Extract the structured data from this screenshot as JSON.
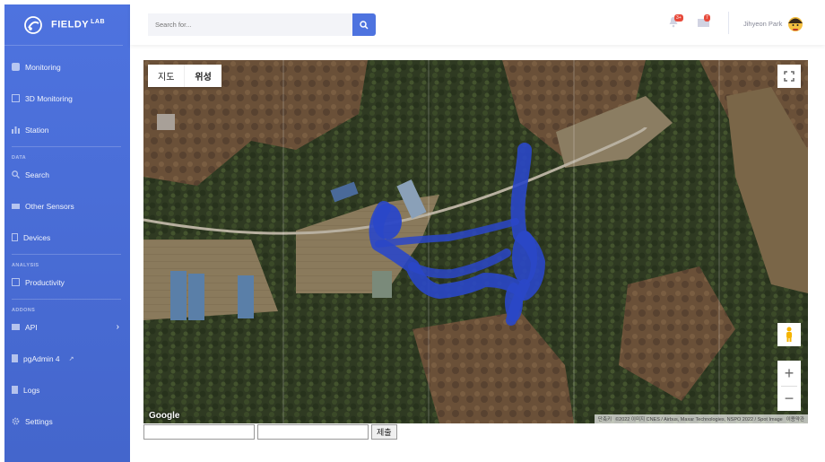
{
  "brand": {
    "name": "FIELDY",
    "sup": "LAB"
  },
  "sidebar": {
    "items": [
      {
        "label": "Monitoring",
        "icon": "map-icon"
      },
      {
        "label": "3D Monitoring",
        "icon": "cube-icon"
      },
      {
        "label": "Station",
        "icon": "bar-chart-icon"
      }
    ],
    "section_data": "DATA",
    "data_items": [
      {
        "label": "Search",
        "icon": "search-icon"
      },
      {
        "label": "Other Sensors",
        "icon": "sensor-icon"
      },
      {
        "label": "Devices",
        "icon": "device-icon"
      }
    ],
    "section_analysis": "ANALYSIS",
    "analysis_items": [
      {
        "label": "Productivity",
        "icon": "table-icon"
      }
    ],
    "section_addons": "ADDONS",
    "addon_items": [
      {
        "label": "API",
        "icon": "folder-icon"
      },
      {
        "label": "pgAdmin 4",
        "icon": "file-icon"
      },
      {
        "label": "Logs",
        "icon": "file-icon"
      },
      {
        "label": "Settings",
        "icon": "gear-icon"
      }
    ]
  },
  "topbar": {
    "search_placeholder": "Search for...",
    "alerts_badge": "3+",
    "messages_badge": "7",
    "user_name": "Jihyeon Park"
  },
  "map": {
    "type_map": "지도",
    "type_satellite": "위성",
    "google": "Google",
    "attribution": "©2022 이미지 CNES / Airbus, Maxar Technologies, NSPO 2022 / Spot Image",
    "attribution_short": "단축키",
    "terms": "이용약관"
  },
  "form": {
    "submit_label": "제출"
  },
  "colors": {
    "accent": "#4e73df",
    "track": "#2a47c8",
    "alert": "#e74a3b"
  }
}
